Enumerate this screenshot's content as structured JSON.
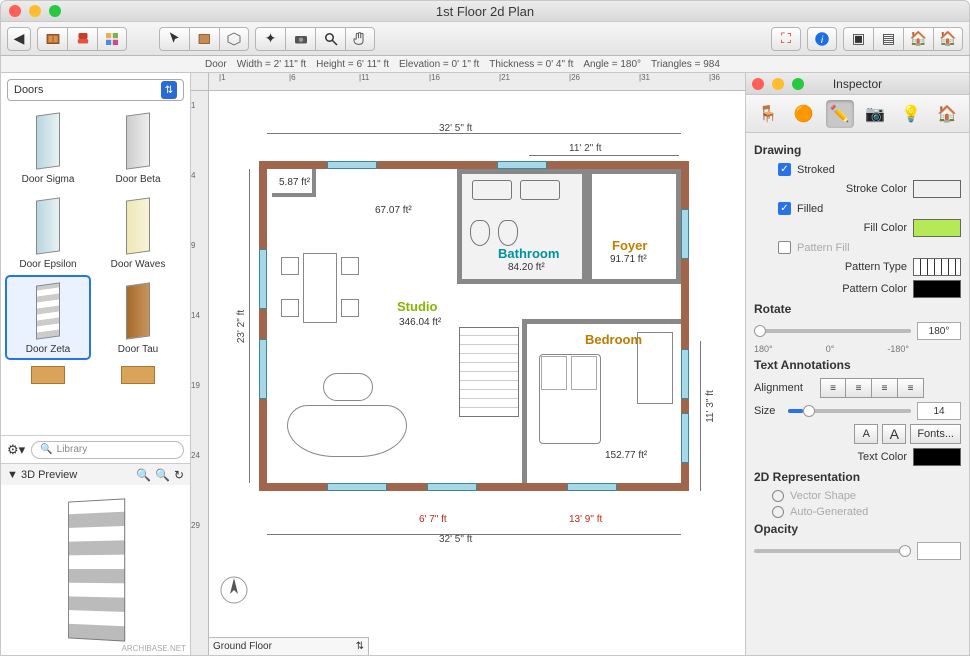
{
  "window": {
    "title": "1st Floor 2d Plan"
  },
  "status": {
    "object": "Door",
    "width_label": "Width =",
    "width": "2' 11\" ft",
    "height_label": "Height =",
    "height": "6' 11\" ft",
    "elevation_label": "Elevation =",
    "elevation": "0' 1\" ft",
    "thickness_label": "Thickness =",
    "thickness": "0' 4\" ft",
    "angle_label": "Angle =",
    "angle": "180°",
    "triangles_label": "Triangles =",
    "triangles": "984"
  },
  "library": {
    "category": "Doors",
    "search_placeholder": "Library",
    "items": [
      {
        "name": "Door Sigma"
      },
      {
        "name": "Door Beta"
      },
      {
        "name": "Door Epsilon"
      },
      {
        "name": "Door Waves"
      },
      {
        "name": "Door Zeta",
        "selected": true
      },
      {
        "name": "Door Tau"
      }
    ],
    "preview_title": "3D Preview",
    "watermark": "ARCHIBASE.NET"
  },
  "canvas": {
    "floor_selector": "Ground Floor",
    "dims": {
      "top_total": "32' 5\" ft",
      "top_right": "11' 2\" ft",
      "left_total": "23' 2\" ft",
      "right_bedroom": "11' 3\" ft",
      "bottom_total": "32' 5\" ft",
      "bottom_left": "6' 7\" ft",
      "bottom_right": "13' 9\" ft"
    },
    "rooms": {
      "studio": {
        "name": "Studio",
        "area": "346.04 ft²",
        "color": "#84b700"
      },
      "bathroom": {
        "name": "Bathroom",
        "area": "84.20 ft²",
        "color": "#0091a0"
      },
      "foyer": {
        "name": "Foyer",
        "area": "91.71 ft²",
        "color": "#c47f00"
      },
      "bedroom": {
        "name": "Bedroom",
        "area": "152.77 ft²",
        "color": "#bf7a00"
      },
      "small1": "5.87 ft²",
      "small2": "67.07 ft²"
    },
    "ruler_h": [
      "|1",
      "|6",
      "|11",
      "|16",
      "|21",
      "|26",
      "|31",
      "|36"
    ],
    "ruler_v": [
      "1",
      "4",
      "9",
      "14",
      "19",
      "24",
      "29"
    ]
  },
  "inspector": {
    "title": "Inspector",
    "drawing": {
      "header": "Drawing",
      "stroked_label": "Stroked",
      "stroked_on": true,
      "stroke_color_label": "Stroke Color",
      "stroke_color": "#000000",
      "filled_label": "Filled",
      "filled_on": true,
      "fill_color_label": "Fill Color",
      "fill_color": "#b3ea55",
      "pattern_fill_label": "Pattern Fill",
      "pattern_type_label": "Pattern Type",
      "pattern_color_label": "Pattern Color",
      "pattern_color": "#000000"
    },
    "rotate": {
      "header": "Rotate",
      "ticks": [
        "180°",
        "0°",
        "-180°"
      ],
      "value": "180°"
    },
    "text": {
      "header": "Text Annotations",
      "alignment_label": "Alignment",
      "size_label": "Size",
      "size_value": "14",
      "fonts_button": "Fonts...",
      "text_color_label": "Text Color",
      "text_color": "#000000"
    },
    "rep2d": {
      "header": "2D Representation",
      "vector_label": "Vector Shape",
      "auto_label": "Auto-Generated"
    },
    "opacity": {
      "header": "Opacity"
    }
  }
}
